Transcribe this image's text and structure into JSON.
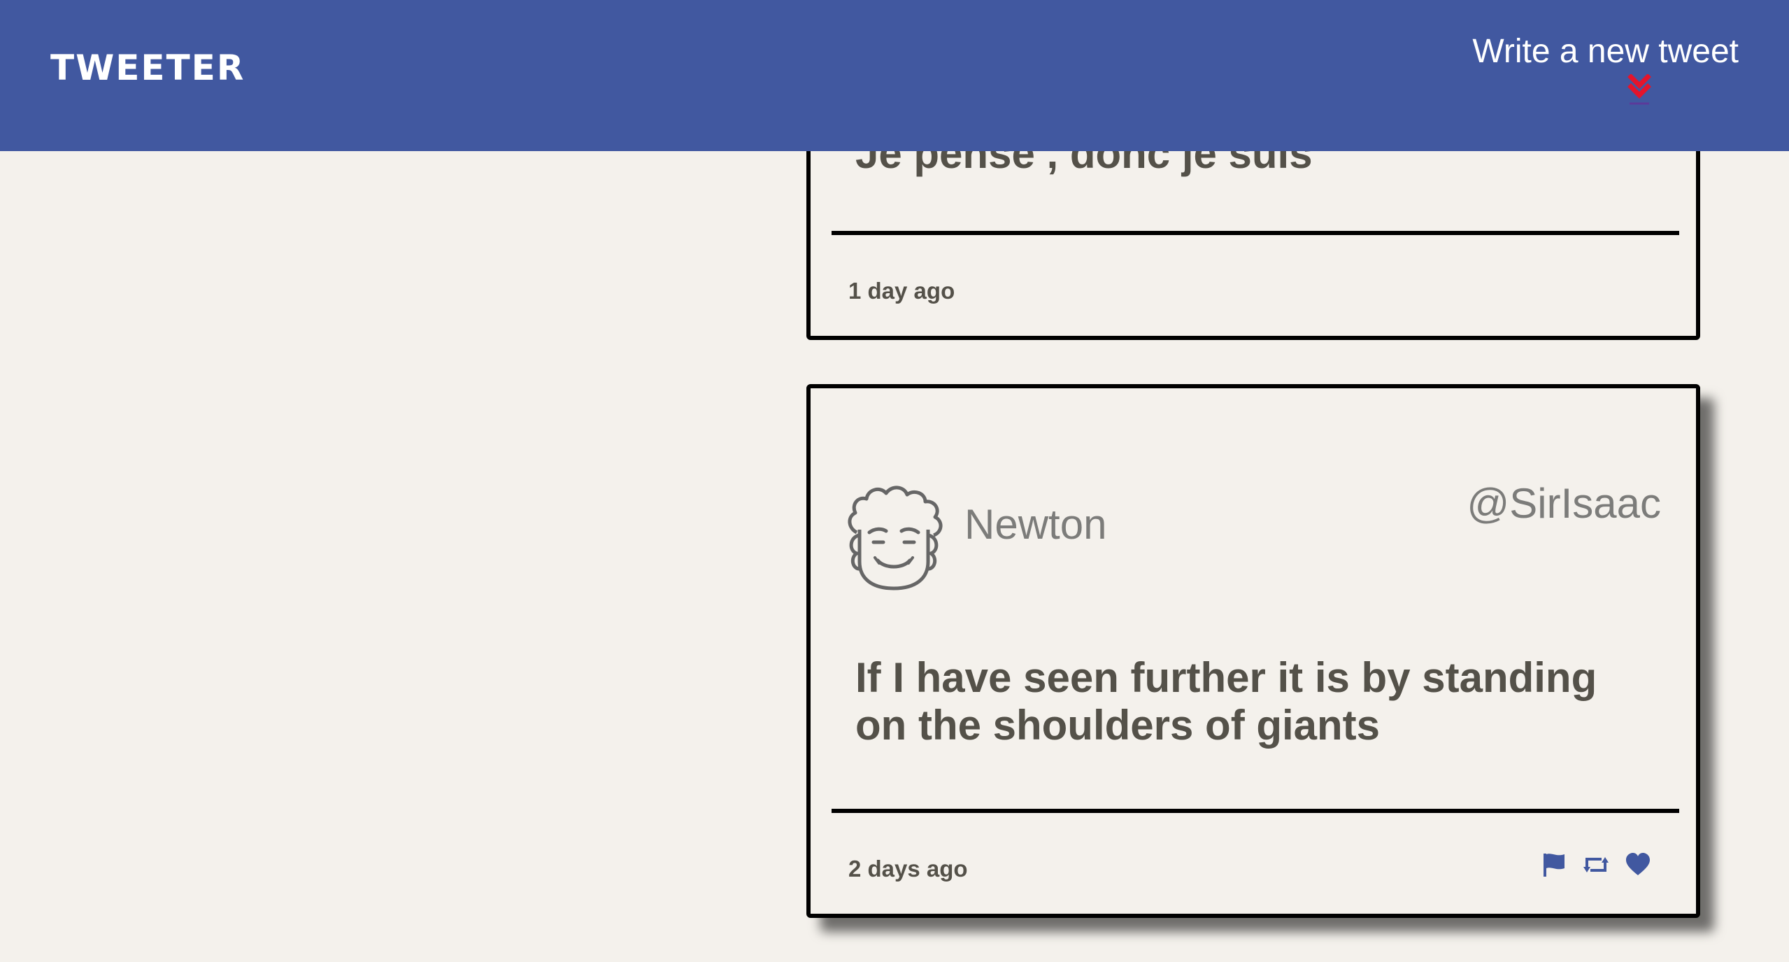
{
  "nav": {
    "brand": "TWEETER",
    "compose_label": "Write a new tweet",
    "compose_arrow_color": "#e4142b",
    "background_color": "#4158a0"
  },
  "tweets": [
    {
      "content": "Je pense , donc je suis",
      "timestamp": "1 day ago"
    },
    {
      "author": "Newton",
      "handle": "@SirIsaac",
      "avatar_icon": "cartoon-face-avatar",
      "content": "If I have seen further it is by standing on the shoulders of giants",
      "timestamp": "2 days ago",
      "actions": {
        "flag_icon": "flag-icon",
        "retweet_icon": "retweet-icon",
        "like_icon": "heart-icon",
        "icon_color": "#4158a0"
      }
    }
  ]
}
